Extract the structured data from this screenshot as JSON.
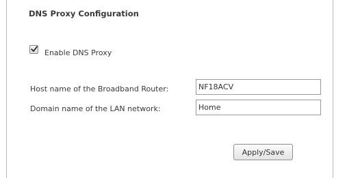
{
  "section": {
    "title": "DNS Proxy Configuration"
  },
  "dns_proxy": {
    "checkbox_label": "Enable DNS Proxy",
    "enabled": true
  },
  "fields": {
    "host_label": "Host name of the Broadband Router:",
    "host_value": "NF18ACV",
    "domain_label": "Domain name of the LAN network:",
    "domain_value": "Home"
  },
  "actions": {
    "apply_label": "Apply/Save"
  }
}
